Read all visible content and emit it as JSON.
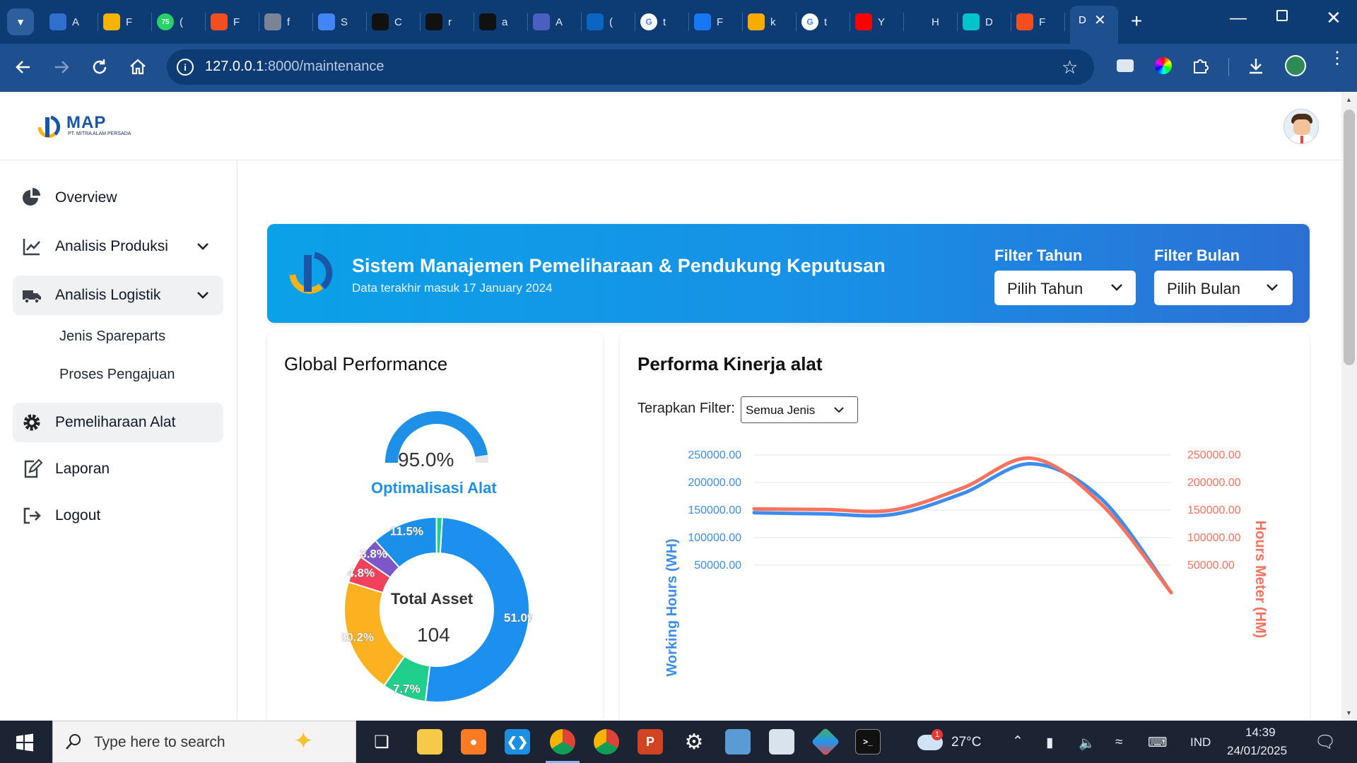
{
  "browser": {
    "tabs": [
      {
        "letter": "A",
        "icon": "azure-devops-icon",
        "color": "#2f6fce"
      },
      {
        "letter": "F",
        "icon": "google-drive-icon",
        "color": "#f4b400"
      },
      {
        "letter": "(",
        "icon": "whatsapp-icon",
        "color": "#25d366",
        "badge": "75"
      },
      {
        "letter": "F",
        "icon": "figma-icon",
        "color": "#f24e1e"
      },
      {
        "letter": "f",
        "icon": "globe-icon",
        "color": "#7a8494"
      },
      {
        "letter": "S",
        "icon": "google-docs-icon",
        "color": "#4285f4"
      },
      {
        "letter": "C",
        "icon": "chatgpt-icon",
        "color": "#111111"
      },
      {
        "letter": "r",
        "icon": "github-icon",
        "color": "#111111"
      },
      {
        "letter": "a",
        "icon": "github-icon",
        "color": "#111111"
      },
      {
        "letter": "A",
        "icon": "triangle-logo-icon",
        "color": "#4a5fc1"
      },
      {
        "letter": "(",
        "icon": "linkedin-icon",
        "color": "#0a66c2"
      },
      {
        "letter": "t",
        "icon": "google-icon",
        "color": "#ffffff"
      },
      {
        "letter": "F",
        "icon": "remote-icon",
        "color": "#1877f2"
      },
      {
        "letter": "k",
        "icon": "google-classroom-icon",
        "color": "#f9ab00"
      },
      {
        "letter": "t",
        "icon": "google-icon",
        "color": "#ffffff"
      },
      {
        "letter": "Y",
        "icon": "youtube-icon",
        "color": "#ff0000"
      },
      {
        "letter": "H",
        "icon": "history-icon",
        "color": "#0d3b73"
      },
      {
        "letter": "D",
        "icon": "canva-icon",
        "color": "#00c4cc"
      },
      {
        "letter": "F",
        "icon": "figma-icon",
        "color": "#f24e1e"
      }
    ],
    "active_tab_letter": "D",
    "url_host": "127.0.0.1",
    "url_rest": ":8000/maintenance"
  },
  "header": {
    "logo_text": "MAP",
    "logo_subtext": "PT. MITRA ALAM PERSADA"
  },
  "sidebar": {
    "items": [
      {
        "label": "Overview",
        "icon": "pie-chart-icon"
      },
      {
        "label": "Analisis Produksi",
        "icon": "line-chart-icon"
      },
      {
        "label": "Analisis Logistik",
        "icon": "truck-icon"
      },
      {
        "label": "Pemeliharaan Alat",
        "icon": "gear-icon"
      },
      {
        "label": "Laporan",
        "icon": "edit-document-icon"
      },
      {
        "label": "Logout",
        "icon": "logout-icon"
      }
    ],
    "subitems": [
      "Jenis Spareparts",
      "Proses Pengajuan"
    ]
  },
  "banner": {
    "title": "Sistem Manajemen Pemeliharaan & Pendukung Keputusan",
    "subtitle": "Data terakhir masuk 17 January 2024",
    "filter_year_label": "Filter Tahun",
    "filter_year_value": "Pilih Tahun",
    "filter_month_label": "Filter Bulan",
    "filter_month_value": "Pilih Bulan"
  },
  "global_performance": {
    "title": "Global Performance",
    "gauge_value": "95.0%",
    "gauge_fraction": 0.95,
    "gauge_label": "Optimalisasi Alat",
    "donut_center_label": "Total Asset",
    "donut_center_value": "104",
    "donut": [
      {
        "label": "51.0%",
        "value": 51.0,
        "color": "#1d8fef"
      },
      {
        "label": "7.7%",
        "value": 7.7,
        "color": "#1fcf8b"
      },
      {
        "label": "20.2%",
        "value": 20.2,
        "color": "#fbb120"
      },
      {
        "label": "4.8%",
        "value": 4.8,
        "color": "#f2415c"
      },
      {
        "label": "3.8%",
        "value": 3.8,
        "color": "#7b58c9"
      },
      {
        "label": "11.5%",
        "value": 11.5,
        "color": "#1b90ea"
      },
      {
        "label": "",
        "value": 1.0,
        "color": "#1ecf8c"
      }
    ]
  },
  "performance_chart": {
    "title": "Performa Kinerja alat",
    "filter_label": "Terapkan Filter:",
    "filter_value": "Semua Jenis"
  },
  "chart_data": {
    "type": "line",
    "x": [
      0,
      1,
      2,
      3,
      4,
      5,
      6
    ],
    "series": [
      {
        "name": "Working Hours (WH)",
        "values": [
          145000,
          143000,
          142000,
          180000,
          234000,
          170000,
          0
        ],
        "color": "#3d8df0",
        "axis": "left"
      },
      {
        "name": "Hours Meter (HM)",
        "values": [
          152000,
          151000,
          150000,
          190000,
          244000,
          160000,
          0
        ],
        "color": "#f8725e",
        "axis": "right"
      }
    ],
    "ylabel": "Working Hours (WH)",
    "y2label": "Hours Meter (HM)",
    "yticks": [
      "250000.00",
      "200000.00",
      "150000.00",
      "100000.00",
      "50000.00"
    ],
    "ylim": [
      0,
      250000
    ],
    "grid": true
  },
  "taskbar": {
    "search_placeholder": "Type here to search",
    "weather_temp": "27°C",
    "weather_badge": "1",
    "language": "IND",
    "time": "14:39",
    "date": "24/01/2025"
  }
}
